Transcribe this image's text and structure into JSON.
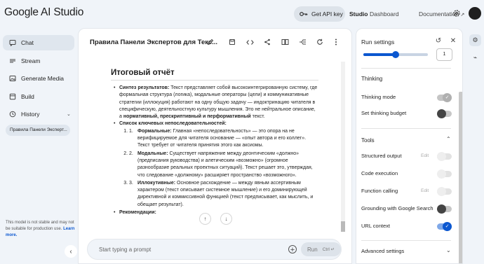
{
  "header": {
    "logo": "Google AI Studio",
    "api_key_button": "Get API key",
    "nav": {
      "studio": "Studio",
      "dashboard": "Dashboard",
      "documentation": "Documentation"
    }
  },
  "sidebar": {
    "items": [
      {
        "label": "Chat",
        "icon": "chat-icon"
      },
      {
        "label": "Stream",
        "icon": "stream-icon"
      },
      {
        "label": "Generate Media",
        "icon": "media-icon"
      },
      {
        "label": "Build",
        "icon": "build-icon"
      },
      {
        "label": "History",
        "icon": "history-icon"
      }
    ],
    "history_entry": "Правила Панели Эксперт...",
    "disclaimer": "This model is not stable and may not be suitable for production use.",
    "learn_more": "Learn more."
  },
  "chat": {
    "title": "Правила Панели Экспертов для Текс...",
    "heading": "Итоговый отчёт",
    "synthesis_label": "Синтез результатов:",
    "synthesis_text": "Текст представляет собой высокоинтегрированную систему, где формальная структура (логика), модальные операторы (цели) и коммуникативные стратегии (иллокуция) работают на одну общую задачу — индоктринацию читателя в специфическую, деятельностную культуру мышления. Это не нейтральное описание, а",
    "synthesis_bold": "нормативный, прескриптивный и перформативный",
    "synthesis_end": "текст.",
    "list_label": "Список ключевых непоследовательностей:",
    "items": [
      {
        "num": "1.",
        "label": "Формальные:",
        "text": "Главная «непоследовательность» — это опора на не верифицируемое для читателя основание — «опыт автора и его коллег». Текст требует от читателя принятия этого как аксиомы."
      },
      {
        "num": "2.",
        "label": "Модальные:",
        "text": "Существует напряжение между деонтическим «должно» (предписания руководства) и алетическим «возможно» (огромное разнообразие реальных проектных ситуаций). Текст решает это, утверждая, что следование «должному» расширяет пространство «возможного»."
      },
      {
        "num": "3.",
        "label": "Иллокутивные:",
        "text": "Основное расхождение — между явным ассертивным характером (текст описывает системное мышление) и его доминирующей директивной и коммиссивной функцией (текст предписывает, как мыслить, и обещает результат)."
      }
    ],
    "cut_off": "Рекомендации:",
    "prompt_placeholder": "Start typing a prompt",
    "run_label": "Run",
    "run_shortcut": "Ctrl"
  },
  "settings": {
    "title": "Run settings",
    "temperature_value": "1",
    "temperature_level": 0.5,
    "thinking_section": "Thinking",
    "thinking_mode": "Thinking mode",
    "thinking_budget": "Set thinking budget",
    "tools_section": "Tools",
    "structured_output": "Structured output",
    "code_execution": "Code execution",
    "function_calling": "Function calling",
    "grounding": "Grounding with Google Search",
    "url_context": "URL context",
    "edit_label": "Edit",
    "advanced": "Advanced settings"
  },
  "colors": {
    "accent": "#0b57d0",
    "background": "#f0f4f9"
  }
}
